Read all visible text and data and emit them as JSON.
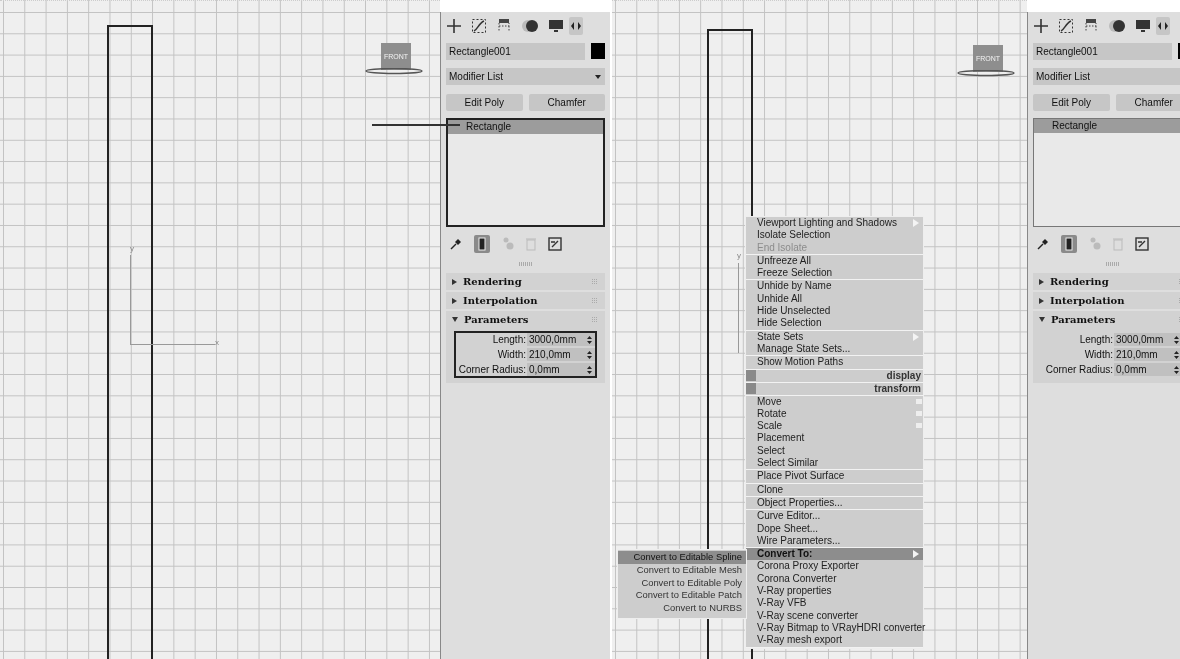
{
  "screens": [
    {
      "viewport": {
        "viewcube_label": "FRONT",
        "y_axis_label": "y",
        "x_axis_label": "x",
        "annotation_arrow": true
      },
      "command_panel": {
        "object_name": "Rectangle001",
        "modifier_list": "Modifier List",
        "buttons": [
          "Edit Poly",
          "Chamfer"
        ],
        "stack": [
          {
            "label": "Rectangle",
            "selected": true
          }
        ],
        "stack_highlighted": true,
        "rollouts": [
          {
            "title": "Rendering",
            "expanded": false
          },
          {
            "title": "Interpolation",
            "expanded": false
          },
          {
            "title": "Parameters",
            "expanded": true,
            "highlighted": true,
            "fields": [
              {
                "label": "Length:",
                "value": "3000,0mm"
              },
              {
                "label": "Width:",
                "value": "210,0mm"
              },
              {
                "label": "Corner Radius:",
                "value": "0,0mm"
              }
            ]
          }
        ]
      }
    },
    {
      "viewport": {
        "viewcube_label": "FRONT",
        "y_axis_label": "y"
      },
      "context_menu": {
        "sections": [
          [
            {
              "label": "Viewport Lighting and Shadows",
              "kind": "submenu",
              "selected": false
            },
            {
              "label": "Isolate Selection",
              "kind": "item",
              "selected": false
            },
            {
              "label": "End Isolate",
              "kind": "disabled",
              "selected": false
            }
          ],
          [
            {
              "label": "Unfreeze All",
              "kind": "item",
              "selected": false
            },
            {
              "label": "Freeze Selection",
              "kind": "item",
              "selected": false
            }
          ],
          [
            {
              "label": "Unhide by Name",
              "kind": "item",
              "selected": false
            },
            {
              "label": "Unhide All",
              "kind": "item",
              "selected": false
            },
            {
              "label": "Hide Unselected",
              "kind": "item",
              "selected": false
            },
            {
              "label": "Hide Selection",
              "kind": "item",
              "selected": false
            }
          ],
          [
            {
              "label": "State Sets",
              "kind": "submenu",
              "selected": false
            },
            {
              "label": "Manage State Sets...",
              "kind": "item",
              "selected": false
            }
          ],
          [
            {
              "label": "Show Motion Paths",
              "kind": "item",
              "selected": false
            }
          ],
          [
            {
              "label": "display",
              "kind": "title"
            }
          ],
          [
            {
              "label": "transform",
              "kind": "title"
            }
          ],
          [
            {
              "label": "Move",
              "kind": "option",
              "selected": false
            },
            {
              "label": "Rotate",
              "kind": "option",
              "selected": false
            },
            {
              "label": "Scale",
              "kind": "option",
              "selected": false
            },
            {
              "label": "Placement",
              "kind": "item",
              "selected": false
            },
            {
              "label": "Select",
              "kind": "item",
              "selected": false
            },
            {
              "label": "Select Similar",
              "kind": "item",
              "selected": false
            }
          ],
          [
            {
              "label": "Place Pivot Surface",
              "kind": "item",
              "selected": false
            }
          ],
          [
            {
              "label": "Clone",
              "kind": "item",
              "selected": false
            }
          ],
          [
            {
              "label": "Object Properties...",
              "kind": "item",
              "selected": false
            }
          ],
          [
            {
              "label": "Curve Editor...",
              "kind": "item",
              "selected": false
            },
            {
              "label": "Dope Sheet...",
              "kind": "item",
              "selected": false
            },
            {
              "label": "Wire Parameters...",
              "kind": "item",
              "selected": false
            }
          ],
          [
            {
              "label": "Convert To:",
              "kind": "submenu",
              "selected": true
            },
            {
              "label": "Corona Proxy Exporter",
              "kind": "item",
              "selected": false
            },
            {
              "label": "Corona Converter",
              "kind": "item",
              "selected": false
            },
            {
              "label": "V-Ray properties",
              "kind": "item",
              "selected": false
            },
            {
              "label": "V-Ray VFB",
              "kind": "item",
              "selected": false
            },
            {
              "label": "V-Ray scene converter",
              "kind": "item",
              "selected": false
            },
            {
              "label": "V-Ray Bitmap to VRayHDRI converter",
              "kind": "item",
              "selected": false
            },
            {
              "label": "V-Ray mesh export",
              "kind": "item",
              "selected": false
            }
          ]
        ]
      },
      "submenu": {
        "items": [
          {
            "label": "Convert to Editable Spline",
            "selected": true
          },
          {
            "label": "Convert to Editable Mesh",
            "selected": false
          },
          {
            "label": "Convert to Editable Poly",
            "selected": false
          },
          {
            "label": "Convert to Editable Patch",
            "selected": false
          },
          {
            "label": "Convert to NURBS",
            "selected": false
          }
        ]
      },
      "command_panel": {
        "object_name": "Rectangle001",
        "modifier_list": "Modifier List",
        "buttons": [
          "Edit Poly",
          "Chamfer"
        ],
        "stack": [
          {
            "label": "Rectangle",
            "selected": true
          }
        ],
        "rollouts": [
          {
            "title": "Rendering",
            "expanded": false
          },
          {
            "title": "Interpolation",
            "expanded": false
          },
          {
            "title": "Parameters",
            "expanded": true,
            "fields": [
              {
                "label": "Length:",
                "value": "3000,0mm"
              },
              {
                "label": "Width:",
                "value": "210,0mm"
              },
              {
                "label": "Corner Radius:",
                "value": "0,0mm"
              }
            ]
          }
        ]
      }
    }
  ]
}
